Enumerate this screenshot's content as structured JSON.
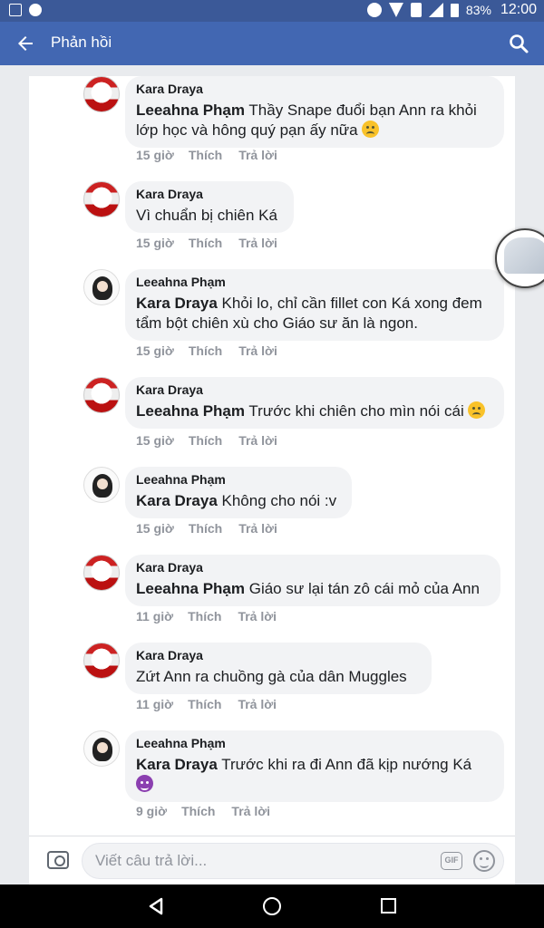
{
  "status_bar": {
    "battery": "83%",
    "time": "12:00",
    "icons": [
      "image-icon",
      "messenger-icon",
      "do-not-disturb-icon",
      "wifi-icon",
      "unknown-question-icon",
      "signal-icon",
      "battery-icon"
    ]
  },
  "header": {
    "title": "Phản hồi",
    "back_icon": "arrow-left-icon",
    "search_icon": "search-icon",
    "color": "#4267b2"
  },
  "comments": [
    {
      "author": "Kara Draya",
      "mention": "Leeahna Phạm",
      "text": " Thầy Snape đuổi bạn Ann ra khỏi lớp học và hông quý pạn ấy nữa",
      "emoji": "sad",
      "time": "15 giờ",
      "like": "Thích",
      "reply": "Trả lời"
    },
    {
      "author": "Kara Draya",
      "mention": "",
      "text": "Vì chuẩn bị chiên Ká",
      "emoji": "",
      "time": "15 giờ",
      "like": "Thích",
      "reply": "Trả lời"
    },
    {
      "author": "Leeahna Phạm",
      "mention": "Kara Draya",
      "text": " Khỏi lo, chỉ cần fillet con Ká xong đem tẩm bột chiên xù cho Giáo sư ăn là ngon.",
      "emoji": "",
      "time": "15 giờ",
      "like": "Thích",
      "reply": "Trả lời"
    },
    {
      "author": "Kara Draya",
      "mention": "Leeahna Phạm",
      "text": " Trước khi chiên cho mìn nói cái",
      "emoji": "sad",
      "time": "15 giờ",
      "like": "Thích",
      "reply": "Trả lời"
    },
    {
      "author": "Leeahna Phạm",
      "mention": "Kara Draya",
      "text": " Không cho nói :v",
      "emoji": "",
      "time": "15 giờ",
      "like": "Thích",
      "reply": "Trả lời"
    },
    {
      "author": "Kara Draya",
      "mention": "Leeahna Phạm",
      "text": " Giáo sư lại tán zô cái mỏ của Ann",
      "emoji": "",
      "time": "11 giờ",
      "like": "Thích",
      "reply": "Trả lời"
    },
    {
      "author": "Kara Draya",
      "mention": "",
      "text": "Zứt Ann ra chuồng gà của dân Muggles",
      "emoji": "",
      "time": "11 giờ",
      "like": "Thích",
      "reply": "Trả lời"
    },
    {
      "author": "Leeahna Phạm",
      "mention": "Kara Draya",
      "text": " Trước khi ra đi Ann đã kịp nướng Ká",
      "emoji": "devil",
      "time": "9 giờ",
      "like": "Thích",
      "reply": "Trả lời"
    }
  ],
  "reply_bar": {
    "placeholder": "Viết câu trả lời...",
    "gif_label": "GIF",
    "camera_icon": "camera-icon",
    "sticker_icon": "sticker-icon"
  },
  "nav_bar": {
    "icons": [
      "back-triangle-icon",
      "home-circle-icon",
      "recents-square-icon"
    ]
  }
}
